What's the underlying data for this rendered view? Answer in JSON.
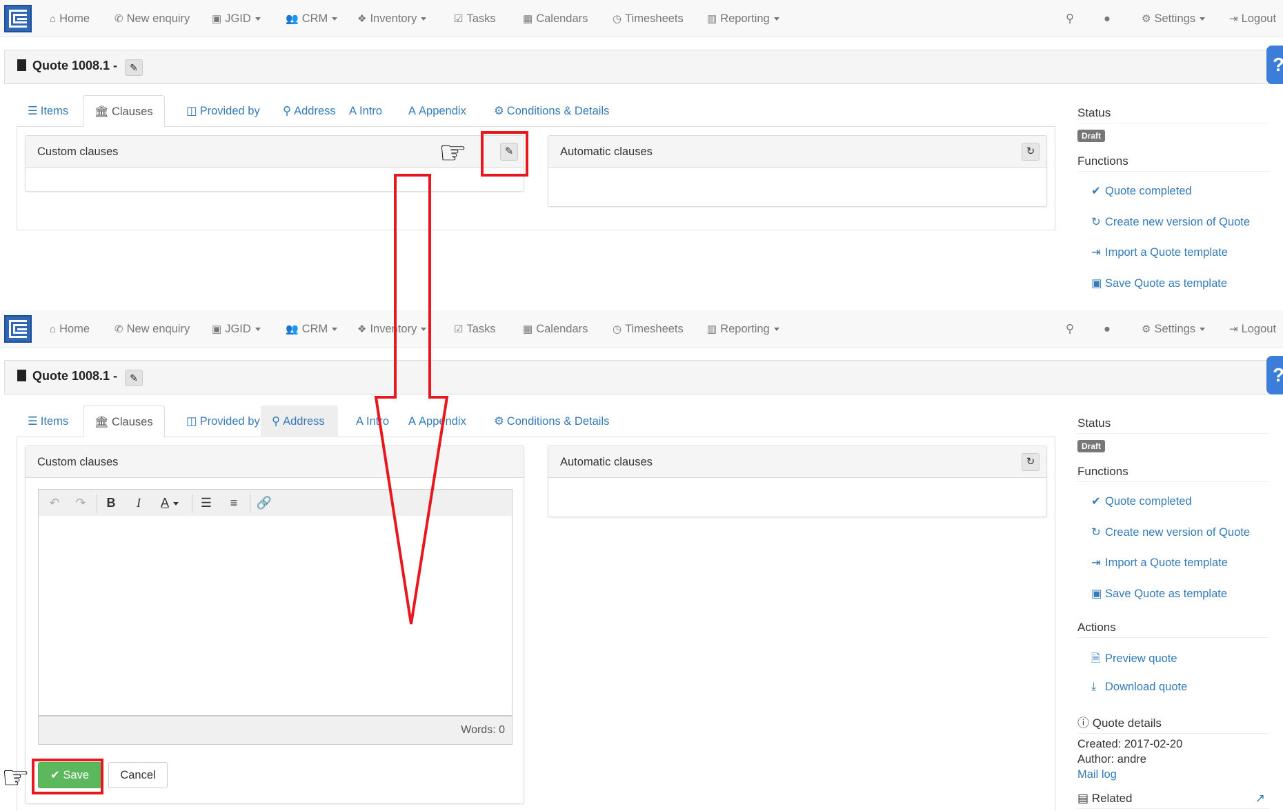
{
  "nav": {
    "home": "Home",
    "new_enquiry": "New enquiry",
    "jgid": "JGID",
    "crm": "CRM",
    "inventory": "Inventory",
    "tasks": "Tasks",
    "calendars": "Calendars",
    "timesheets": "Timesheets",
    "reporting": "Reporting",
    "settings": "Settings",
    "logout": "Logout"
  },
  "page": {
    "title": "Quote 1008.1 -",
    "help": "?"
  },
  "tabs": {
    "items": "Items",
    "clauses": "Clauses",
    "provided_by": "Provided by",
    "address": "Address",
    "intro": "Intro",
    "appendix": "Appendix",
    "conditions": "Conditions & Details"
  },
  "panels": {
    "custom_clauses": "Custom clauses",
    "automatic_clauses": "Automatic clauses"
  },
  "editor": {
    "words": "Words: 0",
    "save": "Save",
    "cancel": "Cancel"
  },
  "sidebar": {
    "status_heading": "Status",
    "status_badge": "Draft",
    "functions_heading": "Functions",
    "functions": [
      "Quote completed",
      "Create new version of Quote",
      "Import a Quote template",
      "Save Quote as template"
    ],
    "actions_heading": "Actions",
    "actions": [
      "Preview quote",
      "Download quote"
    ],
    "details_heading": "Quote details",
    "created": "Created: 2017-02-20",
    "author": "Author: andre",
    "mail_log": "Mail log",
    "related": "Related"
  },
  "colors": {
    "link": "#337ab7",
    "annotation": "#e8161d",
    "save_green": "#5cb85c",
    "badge_gray": "#777777",
    "help_blue": "#3b7dd8"
  }
}
